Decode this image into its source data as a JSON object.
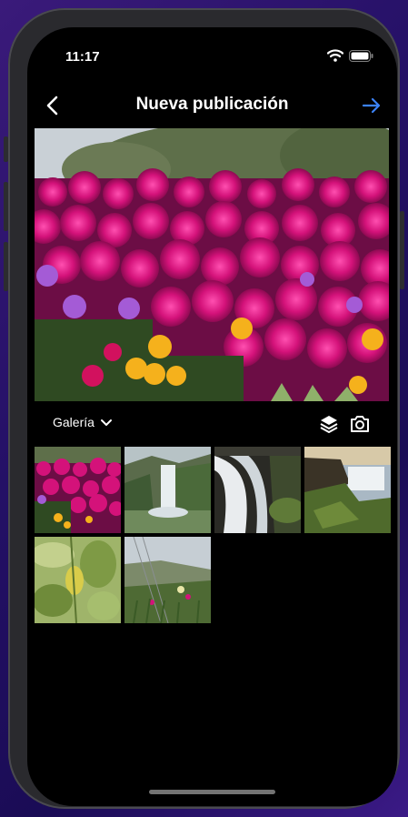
{
  "status": {
    "time": "11:17"
  },
  "header": {
    "title": "Nueva publicación"
  },
  "toolbar": {
    "gallery_label": "Galería"
  },
  "colors": {
    "accent": "#3b82f6",
    "background": "#000000",
    "text": "#ffffff"
  },
  "icons": {
    "back": "chevron-left-icon",
    "next": "arrow-right-icon",
    "dropdown": "chevron-down-icon",
    "layers": "layers-icon",
    "camera": "camera-icon"
  },
  "gallery": {
    "items": [
      {
        "subject": "flowers-magenta"
      },
      {
        "subject": "waterfall-skogafoss"
      },
      {
        "subject": "waterfall-rocks"
      },
      {
        "subject": "waterfall-cliff"
      },
      {
        "subject": "green-leaves"
      },
      {
        "subject": "coastal-plants"
      }
    ]
  }
}
